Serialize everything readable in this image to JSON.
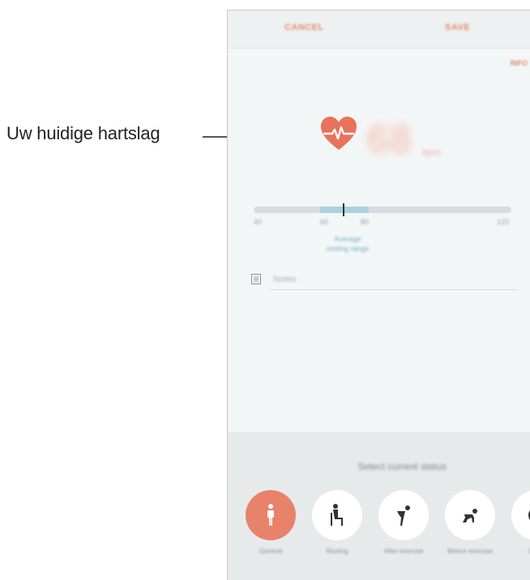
{
  "callout": {
    "label": "Uw huidige hartslag"
  },
  "topbar": {
    "cancel_label": "CANCEL",
    "save_label": "SAVE"
  },
  "measurement": {
    "unit_tag": "INFO",
    "bpm_value": "68",
    "bpm_unit": "bpm",
    "heart_color": "#e8735a"
  },
  "range": {
    "min_label": "40",
    "low_label": "60",
    "high_label": "80",
    "max_label": "120",
    "caption_line1": "Average",
    "caption_line2": "resting range",
    "fill_color": "#a9d2df"
  },
  "notes": {
    "placeholder": "Notes"
  },
  "status": {
    "title": "Select current status",
    "items": [
      {
        "label": "General",
        "icon": "standing-person-icon",
        "active": true
      },
      {
        "label": "Resting",
        "icon": "sitting-person-icon",
        "active": false
      },
      {
        "label": "After exercise",
        "icon": "bending-person-icon",
        "active": false
      },
      {
        "label": "Before exercise",
        "icon": "crouching-person-icon",
        "active": false
      },
      {
        "label": "Other",
        "icon": "more-icon",
        "active": false
      }
    ]
  },
  "colors": {
    "accent": "#e8826a",
    "panel": "#e7eaeb",
    "background": "#f3f6f7"
  }
}
